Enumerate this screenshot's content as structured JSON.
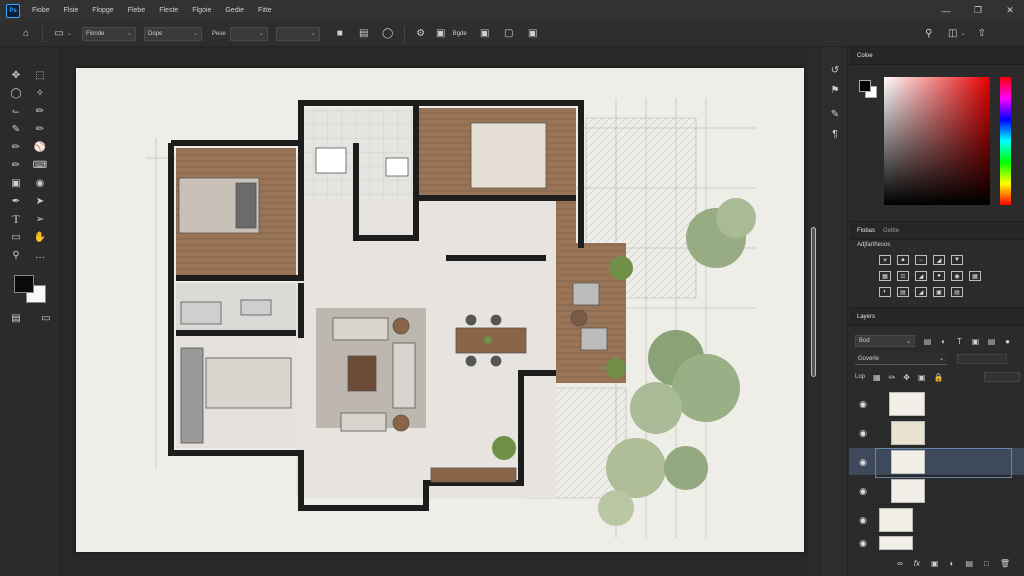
{
  "menubar": {
    "logo_text": "Ps",
    "items": [
      "Fiobe",
      "Flsie",
      "Flopge",
      "Flebe",
      "Fleste",
      "Flgoie",
      "Gedie",
      "Fitte"
    ]
  },
  "window_controls": [
    "minimize-icon",
    "restore-icon",
    "close-icon"
  ],
  "options_bar": {
    "dropdown1": "Flonde",
    "dropdown2": "Dope",
    "dropdown3_label": "Pese",
    "dropdown4": "",
    "label_bgde": "Bgde"
  },
  "color_panel": {
    "tab": "Coloe",
    "hue_accent": "#e60000"
  },
  "adjustments_panel": {
    "tabs": [
      "Fiobas",
      "Gelbe"
    ],
    "title": "Adjfarthesos"
  },
  "layers_panel": {
    "tab": "Layers",
    "filter_label": "Bod",
    "blend_mode": "Goverle",
    "lock_label": "Lop"
  },
  "tools": [
    "move-tool-icon",
    "marquee-tool-icon",
    "lasso-tool-icon",
    "magic-wand-icon",
    "crop-tool-icon",
    "eyedropper-icon",
    "healing-brush-icon",
    "brush-tool-icon",
    "clone-stamp-icon",
    "history-brush-icon",
    "eraser-icon",
    "paint-bucket-icon",
    "blur-tool-icon",
    "dodge-tool-icon",
    "pen-tool-icon",
    "path-select-icon",
    "type-tool-icon",
    "direct-select-icon",
    "shape-tool-icon",
    "hand-tool-icon",
    "zoom-tool-icon",
    "more-tools-icon"
  ],
  "swatch_colors": {
    "foreground": "#0a0a0a",
    "background": "#f7f7f7"
  }
}
